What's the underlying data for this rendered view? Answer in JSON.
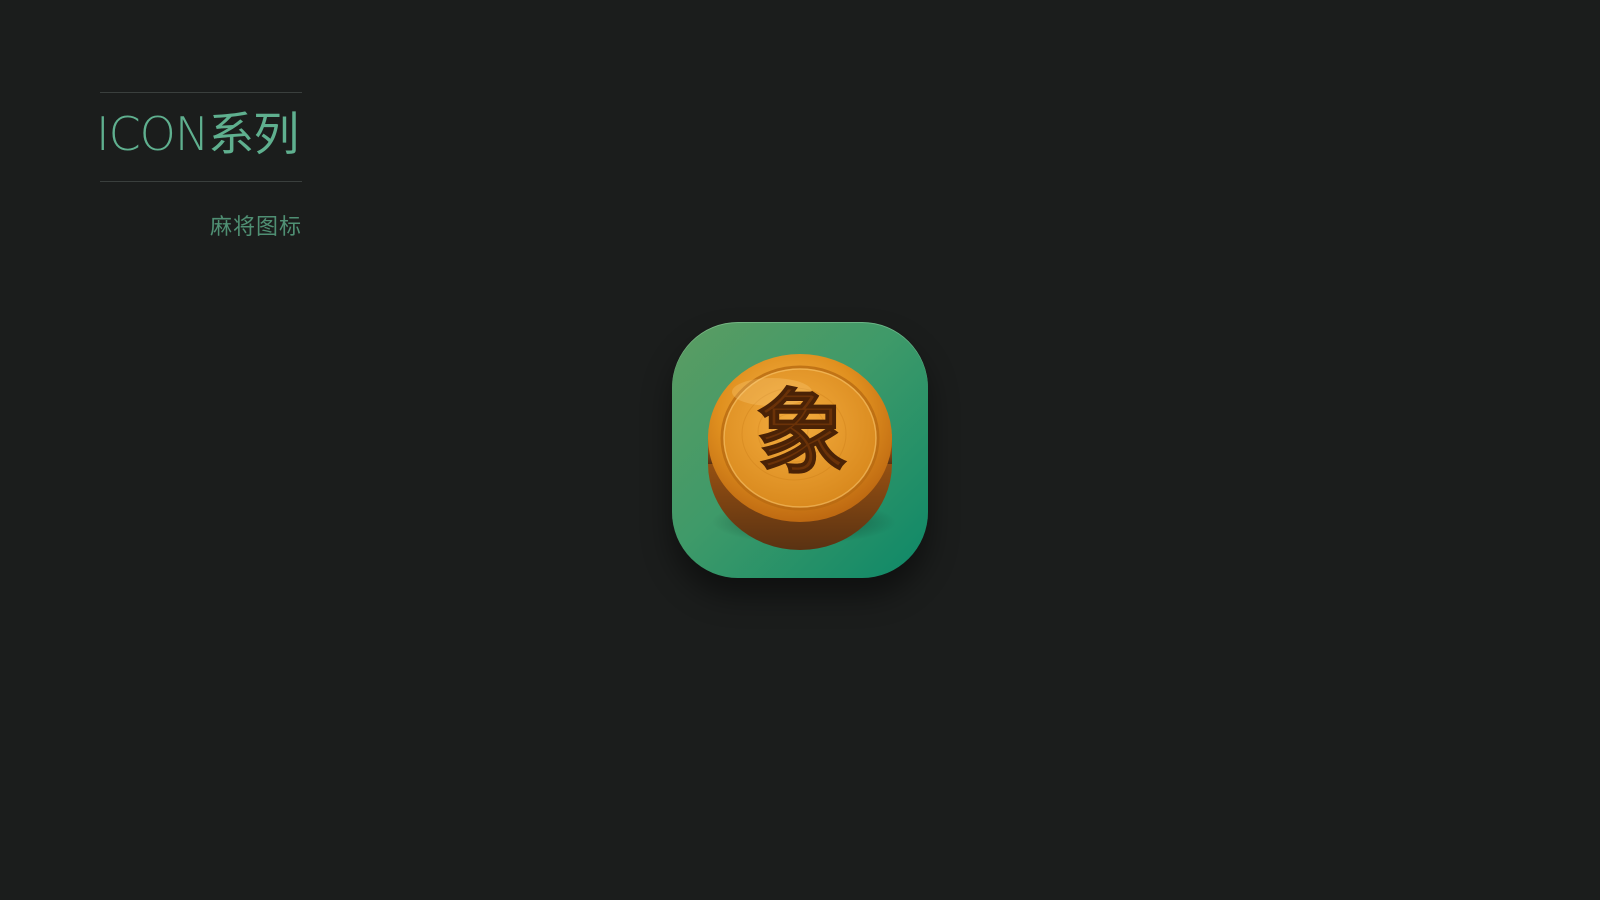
{
  "header": {
    "title": "ICON系列",
    "subtitle": "麻将图标"
  },
  "icon": {
    "name": "xiangqi-elephant-piece",
    "glyph": "象",
    "background_colors": [
      "#5c9c62",
      "#0d8868"
    ],
    "piece_colors": [
      "#f0a22e",
      "#c86a16",
      "#6b3208"
    ]
  }
}
